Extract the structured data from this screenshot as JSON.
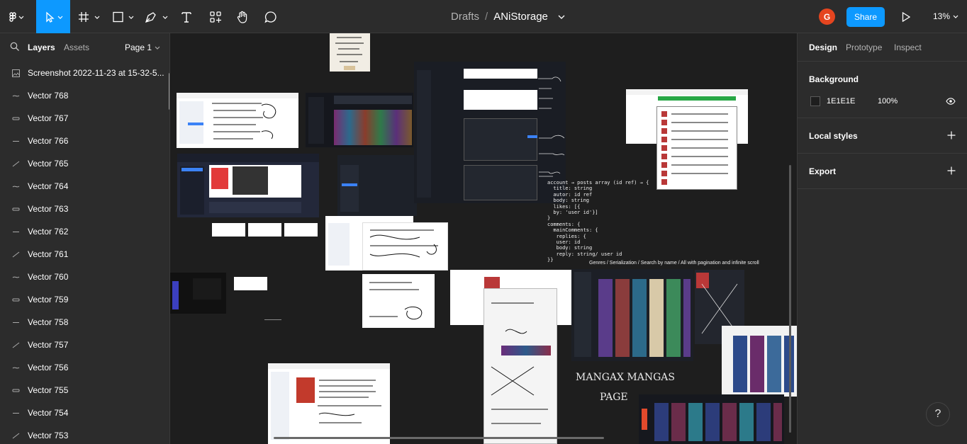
{
  "toolbar": {
    "title_drafts": "Drafts",
    "title_sep": "/",
    "file_name": "ANiStorage",
    "avatar_initial": "G",
    "share_label": "Share",
    "zoom_label": "13%",
    "accent": "#0d99ff",
    "avatar_color": "#e5451f"
  },
  "left_panel": {
    "tabs": {
      "layers": "Layers",
      "assets": "Assets",
      "page": "Page 1"
    },
    "layers": [
      {
        "name": "Screenshot 2022-11-23 at 15-32-5...",
        "icon": "image-icon"
      },
      {
        "name": "Vector 768",
        "icon": "vector-icon"
      },
      {
        "name": "Vector 767",
        "icon": "vector-icon"
      },
      {
        "name": "Vector 766",
        "icon": "vector-icon"
      },
      {
        "name": "Vector 765",
        "icon": "vector-icon"
      },
      {
        "name": "Vector 764",
        "icon": "vector-icon"
      },
      {
        "name": "Vector 763",
        "icon": "vector-icon"
      },
      {
        "name": "Vector 762",
        "icon": "vector-icon"
      },
      {
        "name": "Vector 761",
        "icon": "vector-icon"
      },
      {
        "name": "Vector 760",
        "icon": "vector-icon"
      },
      {
        "name": "Vector 759",
        "icon": "vector-icon"
      },
      {
        "name": "Vector 758",
        "icon": "vector-icon"
      },
      {
        "name": "Vector 757",
        "icon": "vector-icon"
      },
      {
        "name": "Vector 756",
        "icon": "vector-icon"
      },
      {
        "name": "Vector 755",
        "icon": "vector-icon"
      },
      {
        "name": "Vector 754",
        "icon": "vector-icon"
      },
      {
        "name": "Vector 753",
        "icon": "vector-icon"
      }
    ]
  },
  "right_panel": {
    "tabs": {
      "design": "Design",
      "prototype": "Prototype",
      "inspect": "Inspect"
    },
    "background": {
      "title": "Background",
      "hex": "1E1E1E",
      "opacity": "100%",
      "color": "#1e1e1e"
    },
    "local_styles": "Local styles",
    "export": "Export"
  },
  "canvas": {
    "schema_note": "account → posts array (id ref) → {\n  title: string\n  autor: id ref\n  body: string\n  likes: [{\n  by: 'user id'}]\n}\ncomments: {\n  mainComments: {\n   replies: {\n   user: id\n   body: string\n   reply: string/ user id\n}}",
    "genres_note": "Genres / Serialization / Search by name / All with pagination and infinite scroll",
    "handwriting_mangas": "MANGAX MANGAS",
    "handwriting_page": "PAGE"
  },
  "help_label": "?"
}
